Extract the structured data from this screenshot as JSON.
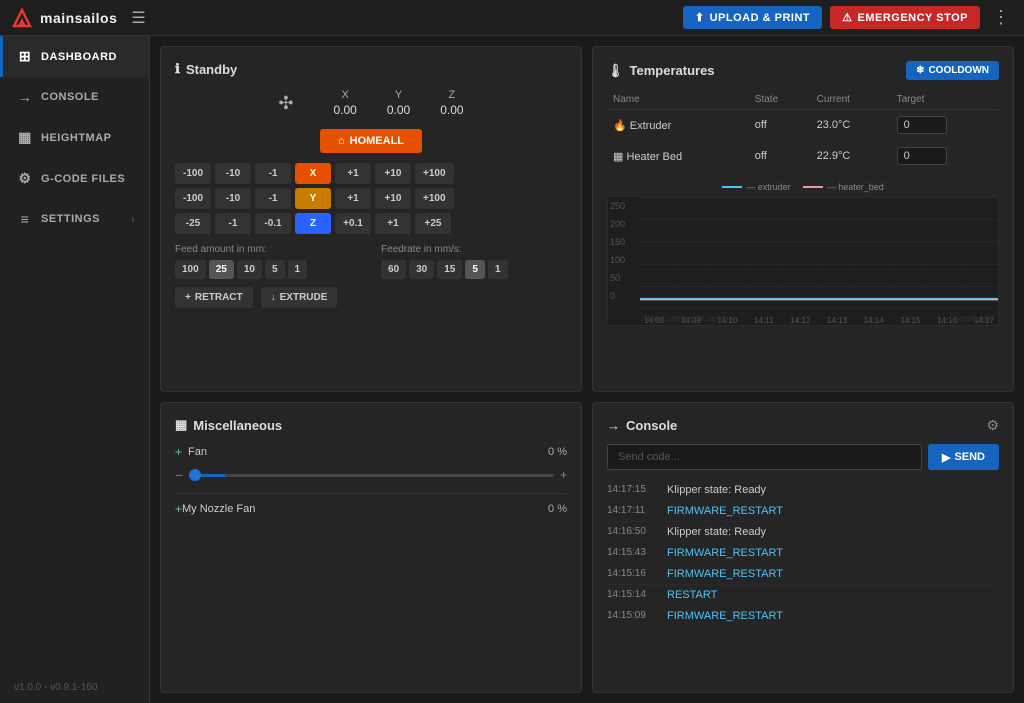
{
  "app": {
    "name": "mainsailos",
    "version": "v1.0.0 - v0.9.1-160"
  },
  "topbar": {
    "upload_label": "Upload & Print",
    "emergency_label": "Emergency Stop",
    "hamburger_label": "menu"
  },
  "sidebar": {
    "items": [
      {
        "id": "dashboard",
        "label": "Dashboard",
        "icon": "⊞",
        "active": true
      },
      {
        "id": "console",
        "label": "Console",
        "icon": "→"
      },
      {
        "id": "heightmap",
        "label": "Heightmap",
        "icon": "▦"
      },
      {
        "id": "gcode",
        "label": "G-Code Files",
        "icon": "⚙"
      },
      {
        "id": "settings",
        "label": "Settings",
        "icon": "≡"
      }
    ]
  },
  "standby": {
    "title": "Standby",
    "axes": [
      {
        "label": "X",
        "value": "0.00"
      },
      {
        "label": "Y",
        "value": "0.00"
      },
      {
        "label": "Z",
        "value": "0.00"
      }
    ],
    "home_all_label": "HOMEALL",
    "x_jog": [
      "-100",
      "-10",
      "-1",
      "X",
      "+1",
      "+10",
      "+100"
    ],
    "y_jog": [
      "-100",
      "-10",
      "-1",
      "Y",
      "+1",
      "+10",
      "+100"
    ],
    "z_jog": [
      "-25",
      "-1",
      "-0.1",
      "Z",
      "+0.1",
      "+1",
      "+25"
    ],
    "feed_label": "Feed amount in mm:",
    "feed_values": [
      "100",
      "25",
      "10",
      "5",
      "1"
    ],
    "feed_active": "25",
    "feedrate_label": "Feedrate in mm/s:",
    "feedrate_values": [
      "60",
      "30",
      "15",
      "5",
      "1"
    ],
    "feedrate_active": "5",
    "retract_label": "RETRACT",
    "extrude_label": "EXTRUDE"
  },
  "temperatures": {
    "title": "Temperatures",
    "cooldown_label": "COOLDOWN",
    "columns": [
      "Name",
      "State",
      "Current",
      "Target"
    ],
    "rows": [
      {
        "icon": "🔥",
        "name": "Extruder",
        "state": "off",
        "current": "23.0°C",
        "target": "0"
      },
      {
        "icon": "▦",
        "name": "Heater Bed",
        "state": "off",
        "current": "22.9°C",
        "target": "0"
      }
    ],
    "chart": {
      "legend": [
        "extruder",
        "heater_bed"
      ],
      "legend_colors": [
        "#4fc3f7",
        "#ef9a9a"
      ],
      "y_labels": [
        "250",
        "200",
        "150",
        "100",
        "50",
        "0"
      ],
      "x_labels": [
        "14:08",
        "14:09",
        "14:10",
        "14:11",
        "14:12",
        "14:13",
        "14:14",
        "14:15",
        "14:16",
        "14:17"
      ],
      "watermark": "Canvs.0.com",
      "version": "Non-Commercial Version"
    }
  },
  "miscellaneous": {
    "title": "Miscellaneous",
    "fan_label": "Fan",
    "fan_pct": "0 %",
    "fan_slider_value": 0,
    "nozzle_label": "My Nozzle Fan",
    "nozzle_pct": "0 %"
  },
  "console": {
    "title": "Console",
    "send_placeholder": "Send code...",
    "send_label": "SEND",
    "logs": [
      {
        "time": "14:17:15",
        "msg": "Klipper state: Ready",
        "type": "info"
      },
      {
        "time": "14:17:11",
        "msg": "FIRMWARE_RESTART",
        "type": "cmd"
      },
      {
        "time": "14:16:50",
        "msg": "Klipper state: Ready",
        "type": "info"
      },
      {
        "time": "14:15:43",
        "msg": "FIRMWARE_RESTART",
        "type": "cmd"
      },
      {
        "time": "14:15:16",
        "msg": "FIRMWARE_RESTART",
        "type": "cmd"
      },
      {
        "time": "14:15:14",
        "msg": "RESTART",
        "type": "cmd"
      },
      {
        "time": "14:15:09",
        "msg": "FIRMWARE_RESTART",
        "type": "cmd"
      }
    ]
  }
}
